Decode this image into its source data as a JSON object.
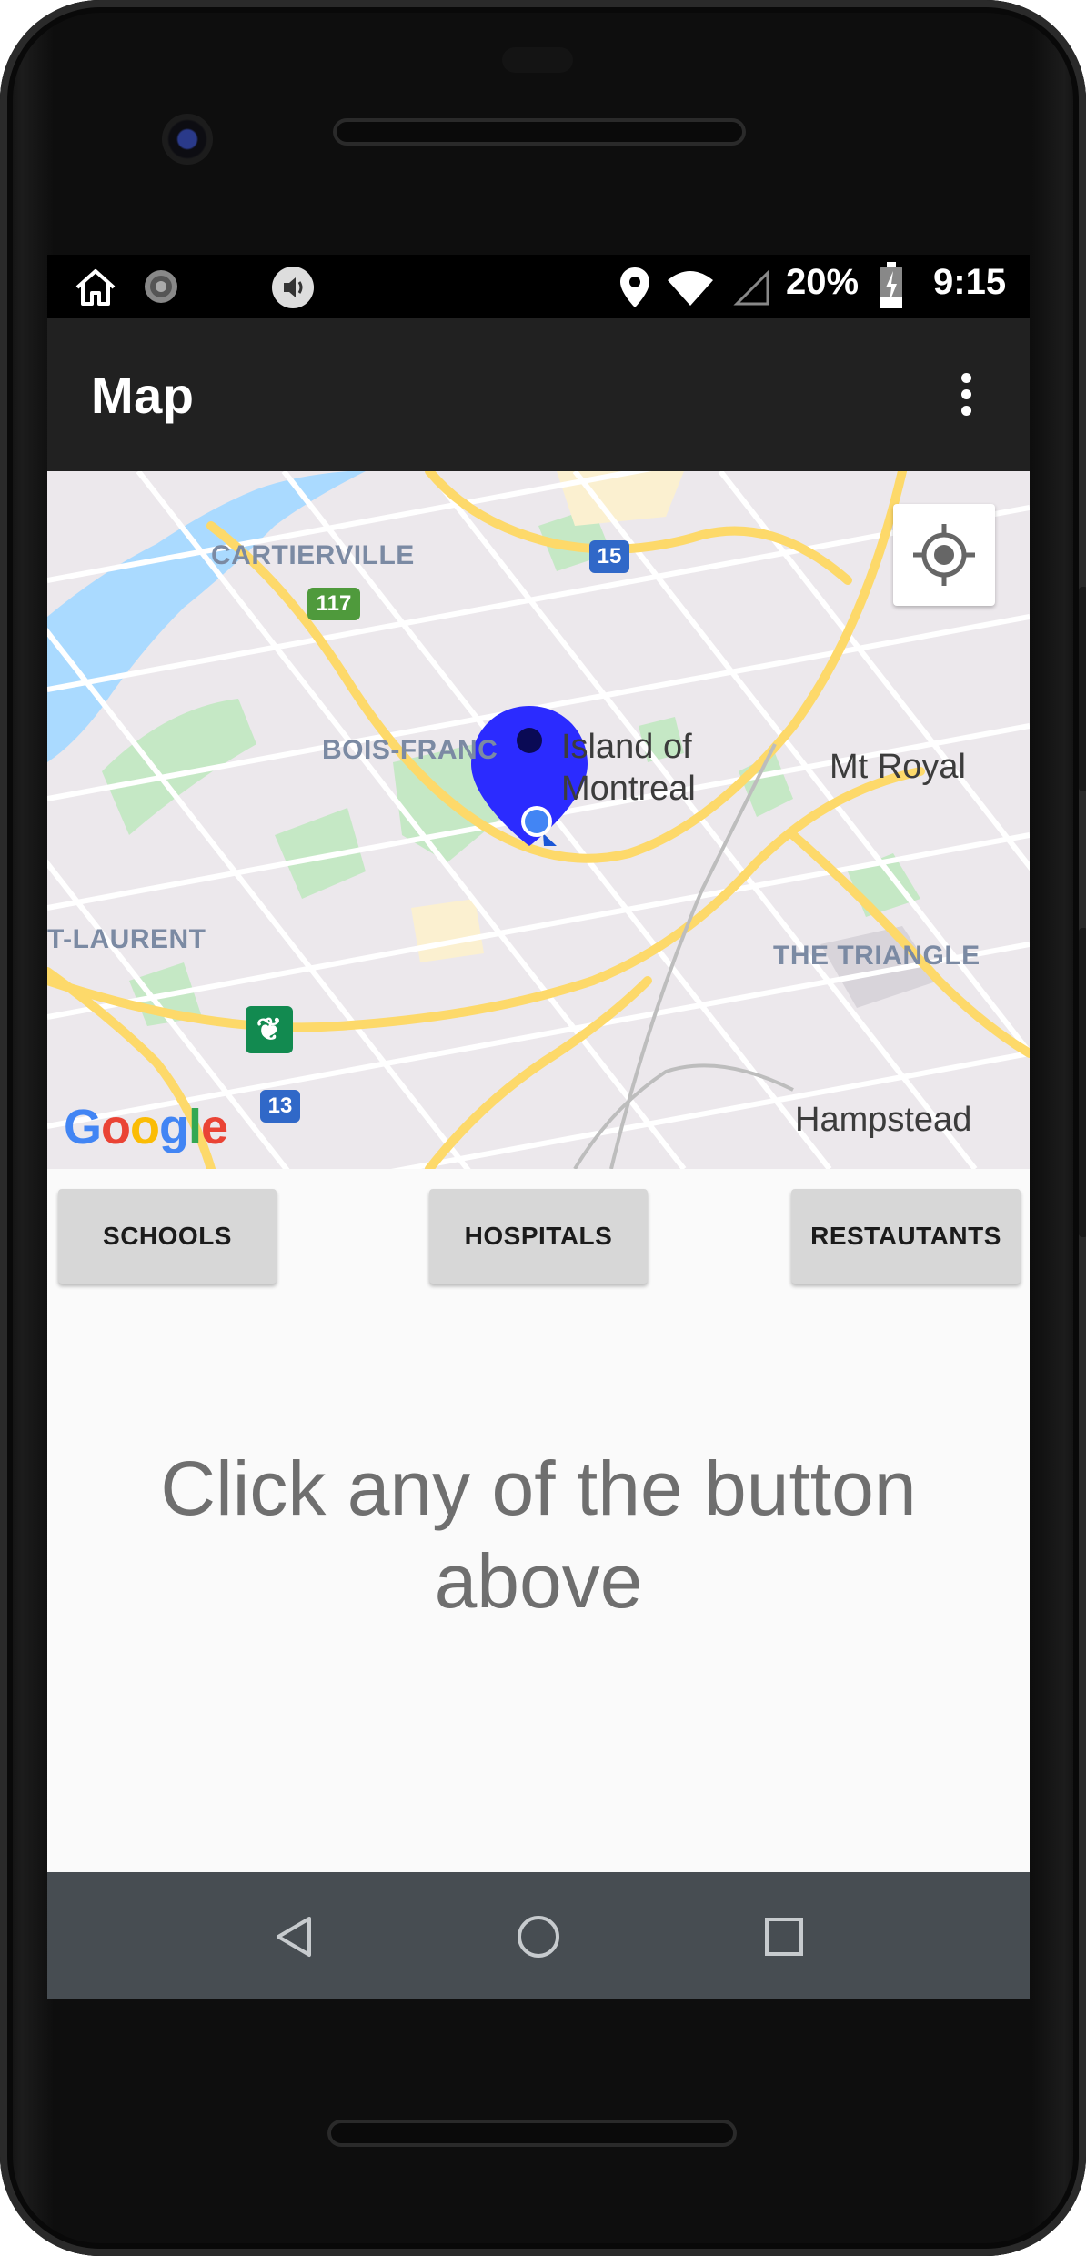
{
  "status_bar": {
    "battery": "20%",
    "time": "9:15",
    "icons": [
      "home-icon",
      "sync-icon",
      "volume-icon",
      "location-icon",
      "wifi-icon",
      "signal-icon",
      "battery-charging-icon"
    ]
  },
  "app_bar": {
    "title": "Map",
    "menu_icon": "more-vert-icon"
  },
  "map": {
    "labels": {
      "cartierville": "CARTIERVILLE",
      "bois_franc": "BOIS-FRANC",
      "st_laurent": "T-LAURENT",
      "the_triangle": "THE TRIANGLE",
      "island": "Island of\nMontreal",
      "island_line1": "Island of",
      "island_line2": "Montreal",
      "mt_royal": "Mt Royal",
      "hampstead": "Hampstead"
    },
    "shields": {
      "hwy15": "15",
      "hwy117": "117",
      "hwy13": "13"
    },
    "google_logo": "Google",
    "my_location_icon": "my-location-icon",
    "marker_icon": "map-pin-icon",
    "colors": {
      "water": "#aadaff",
      "park": "#c5e8c5",
      "highway": "#fdd96a",
      "marker": "#2b2bff"
    }
  },
  "buttons": {
    "schools": "SCHOOLS",
    "hospitals": "HOSPITALS",
    "restaurants": "RESTAUTANTS"
  },
  "content": {
    "prompt": "Click any of the button above"
  },
  "nav_bar": {
    "back": "back-icon",
    "home": "home-circle-icon",
    "recents": "recents-icon"
  }
}
